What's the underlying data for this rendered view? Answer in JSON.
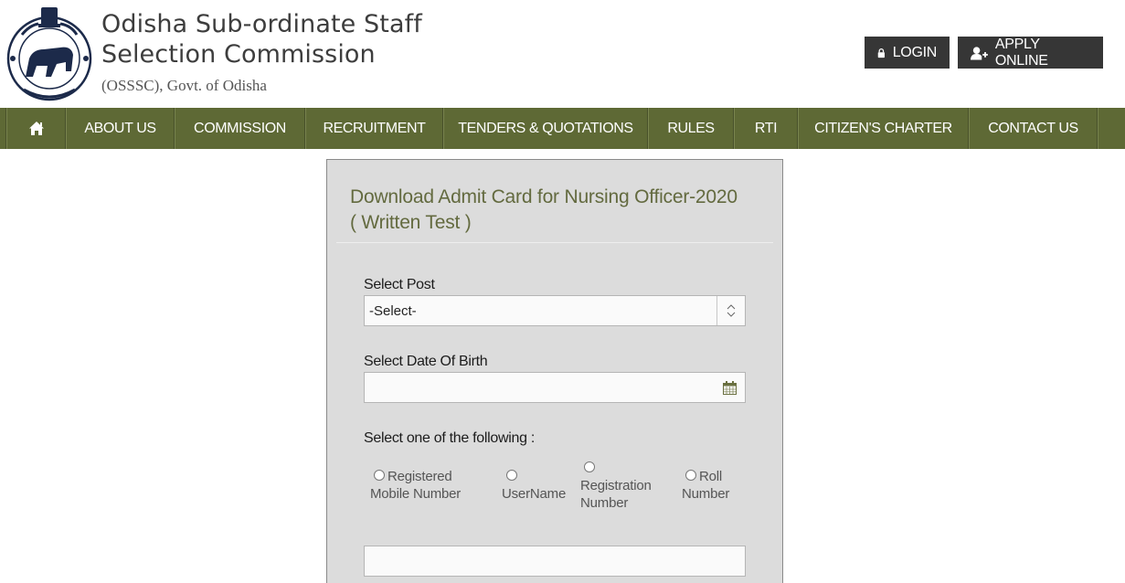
{
  "header": {
    "title_line1": "Odisha Sub-ordinate Staff",
    "title_line2": "Selection Commission",
    "subtitle": "(OSSSC), Govt. of Odisha",
    "login_label": "LOGIN",
    "apply_label": "APPLY ONLINE",
    "login_icon": "lock-icon",
    "apply_icon": "user-plus-icon",
    "logo": "odisha-government-emblem"
  },
  "nav": {
    "home_icon": "home-icon",
    "items": [
      {
        "label": "ABOUT US"
      },
      {
        "label": "COMMISSION"
      },
      {
        "label": "RECRUITMENT"
      },
      {
        "label": "TENDERS & QUOTATIONS"
      },
      {
        "label": "RULES"
      },
      {
        "label": "RTI"
      },
      {
        "label": "CITIZEN'S CHARTER"
      },
      {
        "label": "CONTACT US"
      }
    ]
  },
  "form": {
    "title_line1": "Download Admit Card for Nursing Officer-2020",
    "title_line2": "( Written Test )",
    "post_label": "Select Post",
    "post_value": "-Select-",
    "dob_label": "Select Date Of Birth",
    "dob_value": "",
    "choice_label": "Select one of the following :",
    "options": [
      {
        "line1": "Registered",
        "line2": "Mobile Number",
        "checked": false
      },
      {
        "line1": "",
        "line2": "UserName",
        "checked": false
      },
      {
        "line1": "Registration",
        "line2": "Number",
        "checked": false
      },
      {
        "line1": "Roll",
        "line2": "Number",
        "checked": false
      }
    ],
    "identifier_value": ""
  },
  "colors": {
    "nav_bg": "#5e6935",
    "button_bg": "#363636",
    "panel_bg": "#dcdcdc",
    "title_color": "#636a3f"
  }
}
